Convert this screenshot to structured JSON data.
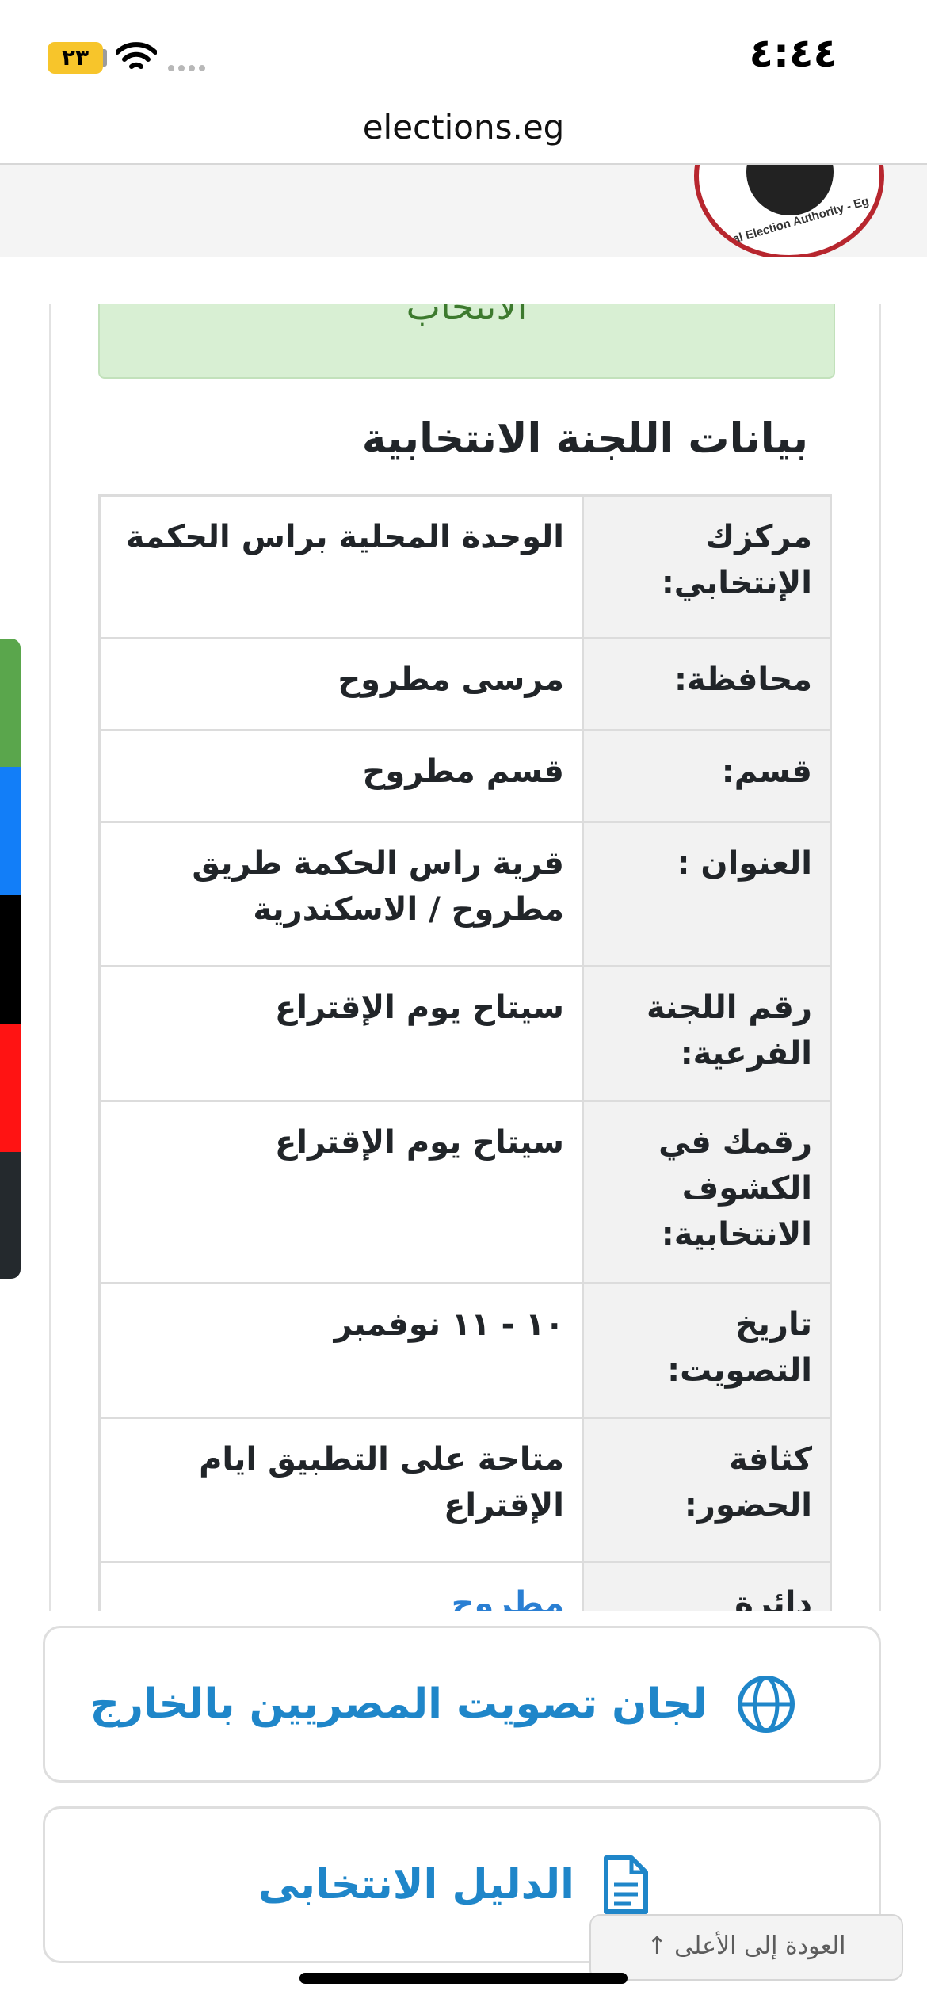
{
  "status_bar": {
    "time": "٤:٤٤",
    "battery": "٢٣"
  },
  "browser": {
    "url": "elections.eg"
  },
  "header": {
    "logo_text": "ional Election Authority - Eg"
  },
  "alert": {
    "text": "الانتخاب"
  },
  "section": {
    "title": "بيانات اللجنة الانتخابية"
  },
  "info_rows": [
    {
      "label": "مركزك الإنتخابي:",
      "value": "الوحدة المحلية براس الحكمة"
    },
    {
      "label": "محافظة:",
      "value": "مرسى مطروح"
    },
    {
      "label": "قسم:",
      "value": "قسم مطروح"
    },
    {
      "label": "العنوان :",
      "value": "قرية راس الحكمة طريق مطروح / الاسكندرية"
    },
    {
      "label": "رقم اللجنة الفرعية:",
      "value": "سيتاح يوم الإقتراع"
    },
    {
      "label": "رقمك في الكشوف الانتخابية:",
      "value": "سيتاح يوم الإقتراع"
    },
    {
      "label": "تاريخ التصويت:",
      "value": "١٠ - ١١ نوفمبر"
    },
    {
      "label": "كثافة الحضور:",
      "value": "متاحة على التطبيق ايام الإقتراع"
    },
    {
      "label": "دائرة",
      "value": "مطروح"
    }
  ],
  "buttons": {
    "abroad": "لجان تصويت المصريين بالخارج",
    "guide": "الدليل الانتخابى"
  },
  "back_to_top": "العودة إلى الأعلى ↑",
  "colors": {
    "side_tabs": [
      "#5aa64c",
      "#127ef8",
      "#000000",
      "#ff1313",
      "#24292d"
    ],
    "accent": "#1f86c9",
    "alert_bg": "#d8efd3"
  }
}
